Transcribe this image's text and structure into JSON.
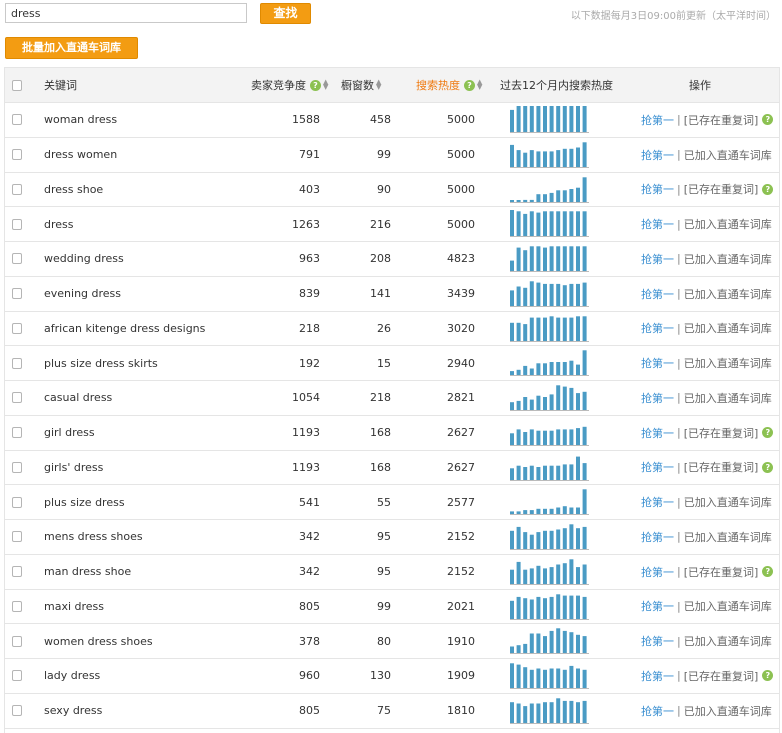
{
  "search": {
    "value": "dress",
    "button_label": "查找"
  },
  "update_note": "以下数据每月3日09:00前更新（太平洋时间）",
  "batch_button_label": "批量加入直通车词库",
  "columns": {
    "keyword": "关键词",
    "competition": "卖家竞争度",
    "window": "橱窗数",
    "heat": "搜索热度",
    "trend": "过去12个月内搜索热度",
    "ops": "操作"
  },
  "colors": {
    "accent": "#f39c12",
    "bar": "#4a9bc4",
    "link": "#3a8fd1",
    "help_icon": "#8cc152"
  },
  "op_grab_label": "抢第一",
  "rows": [
    {
      "keyword": "woman dress",
      "competition": "1588",
      "window": "458",
      "heat": "5000",
      "status": "[已存在重复词]",
      "help": true,
      "trend": [
        0.85,
        1,
        1,
        1,
        1,
        1,
        1,
        1,
        1,
        1,
        1,
        1
      ]
    },
    {
      "keyword": "dress women",
      "competition": "791",
      "window": "99",
      "heat": "5000",
      "status": "已加入直通车词库",
      "help": false,
      "trend": [
        0.85,
        0.65,
        0.55,
        0.65,
        0.6,
        0.6,
        0.6,
        0.65,
        0.7,
        0.7,
        0.75,
        0.95
      ]
    },
    {
      "keyword": "dress shoe",
      "competition": "403",
      "window": "90",
      "heat": "5000",
      "status": "[已存在重复词]",
      "help": true,
      "trend": [
        0.05,
        0.05,
        0.08,
        0.08,
        0.3,
        0.3,
        0.35,
        0.45,
        0.45,
        0.5,
        0.55,
        0.95
      ]
    },
    {
      "keyword": "dress",
      "competition": "1263",
      "window": "216",
      "heat": "5000",
      "status": "已加入直通车词库",
      "help": false,
      "trend": [
        1,
        0.95,
        0.85,
        0.95,
        0.9,
        0.95,
        0.95,
        0.95,
        0.95,
        0.95,
        0.95,
        0.95
      ]
    },
    {
      "keyword": "wedding dress",
      "competition": "963",
      "window": "208",
      "heat": "4823",
      "status": "已加入直通车词库",
      "help": false,
      "trend": [
        0.4,
        0.9,
        0.8,
        0.95,
        0.95,
        0.9,
        0.95,
        0.95,
        0.95,
        0.95,
        0.95,
        0.95
      ]
    },
    {
      "keyword": "evening dress",
      "competition": "839",
      "window": "141",
      "heat": "3439",
      "status": "已加入直通车词库",
      "help": false,
      "trend": [
        0.6,
        0.75,
        0.7,
        0.95,
        0.9,
        0.85,
        0.85,
        0.85,
        0.8,
        0.85,
        0.85,
        0.9
      ]
    },
    {
      "keyword": "african kitenge dress designs",
      "competition": "218",
      "window": "26",
      "heat": "3020",
      "status": "已加入直通车词库",
      "help": false,
      "trend": [
        0.7,
        0.7,
        0.65,
        0.9,
        0.9,
        0.9,
        0.95,
        0.9,
        0.9,
        0.9,
        0.95,
        0.95
      ]
    },
    {
      "keyword": "plus size dress skirts",
      "competition": "192",
      "window": "15",
      "heat": "2940",
      "status": "已加入直通车词库",
      "help": false,
      "trend": [
        0.15,
        0.2,
        0.35,
        0.25,
        0.45,
        0.45,
        0.5,
        0.5,
        0.5,
        0.55,
        0.4,
        0.95
      ]
    },
    {
      "keyword": "casual dress",
      "competition": "1054",
      "window": "218",
      "heat": "2821",
      "status": "已加入直通车词库",
      "help": false,
      "trend": [
        0.3,
        0.35,
        0.5,
        0.4,
        0.55,
        0.5,
        0.6,
        0.95,
        0.9,
        0.85,
        0.65,
        0.7
      ]
    },
    {
      "keyword": "girl dress",
      "competition": "1193",
      "window": "168",
      "heat": "2627",
      "status": "[已存在重复词]",
      "help": true,
      "trend": [
        0.45,
        0.6,
        0.5,
        0.6,
        0.55,
        0.55,
        0.55,
        0.6,
        0.6,
        0.6,
        0.65,
        0.7
      ]
    },
    {
      "keyword": "girls' dress",
      "competition": "1193",
      "window": "168",
      "heat": "2627",
      "status": "[已存在重复词]",
      "help": true,
      "trend": [
        0.45,
        0.55,
        0.5,
        0.55,
        0.5,
        0.55,
        0.55,
        0.55,
        0.6,
        0.6,
        0.9,
        0.65
      ]
    },
    {
      "keyword": "plus size dress",
      "competition": "541",
      "window": "55",
      "heat": "2577",
      "status": "已加入直通车词库",
      "help": false,
      "trend": [
        0.1,
        0.1,
        0.15,
        0.15,
        0.2,
        0.2,
        0.2,
        0.25,
        0.3,
        0.25,
        0.25,
        0.95
      ]
    },
    {
      "keyword": "mens dress shoes",
      "competition": "342",
      "window": "95",
      "heat": "2152",
      "status": "已加入直通车词库",
      "help": false,
      "trend": [
        0.7,
        0.85,
        0.65,
        0.55,
        0.65,
        0.7,
        0.7,
        0.75,
        0.8,
        0.95,
        0.8,
        0.85
      ]
    },
    {
      "keyword": "man dress shoe",
      "competition": "342",
      "window": "95",
      "heat": "2152",
      "status": "[已存在重复词]",
      "help": true,
      "trend": [
        0.55,
        0.85,
        0.55,
        0.6,
        0.7,
        0.6,
        0.65,
        0.75,
        0.8,
        0.95,
        0.65,
        0.75
      ]
    },
    {
      "keyword": "maxi dress",
      "competition": "805",
      "window": "99",
      "heat": "2021",
      "status": "已加入直通车词库",
      "help": false,
      "trend": [
        0.7,
        0.85,
        0.8,
        0.75,
        0.85,
        0.8,
        0.85,
        0.95,
        0.9,
        0.9,
        0.9,
        0.85
      ]
    },
    {
      "keyword": "women dress shoes",
      "competition": "378",
      "window": "80",
      "heat": "1910",
      "status": "已加入直通车词库",
      "help": false,
      "trend": [
        0.25,
        0.3,
        0.35,
        0.75,
        0.75,
        0.65,
        0.85,
        0.95,
        0.85,
        0.8,
        0.7,
        0.65
      ]
    },
    {
      "keyword": "lady dress",
      "competition": "960",
      "window": "130",
      "heat": "1909",
      "status": "[已存在重复词]",
      "help": true,
      "trend": [
        0.95,
        0.9,
        0.8,
        0.7,
        0.75,
        0.7,
        0.75,
        0.75,
        0.7,
        0.85,
        0.75,
        0.7
      ]
    },
    {
      "keyword": "sexy dress",
      "competition": "805",
      "window": "75",
      "heat": "1810",
      "status": "已加入直通车词库",
      "help": false,
      "trend": [
        0.8,
        0.75,
        0.65,
        0.75,
        0.75,
        0.8,
        0.8,
        0.95,
        0.85,
        0.85,
        0.8,
        0.85
      ]
    }
  ]
}
